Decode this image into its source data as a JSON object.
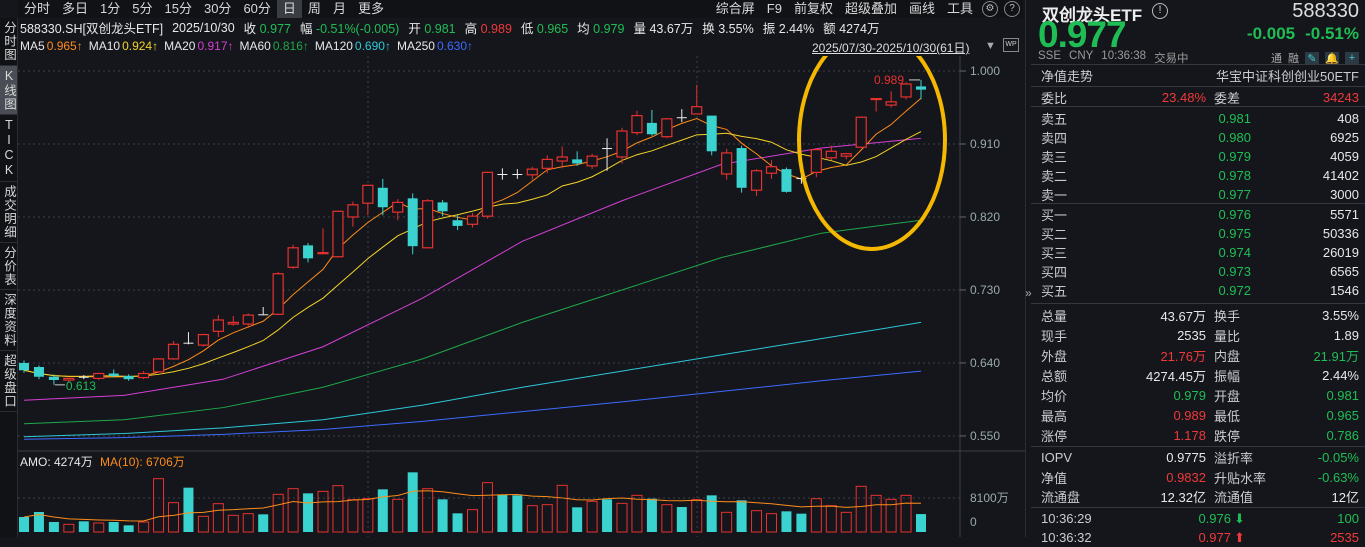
{
  "toolbar": {
    "periods": [
      "分时",
      "多日",
      "1分",
      "5分",
      "15分",
      "30分",
      "60分",
      "日",
      "周",
      "月",
      "更多"
    ],
    "active": "日",
    "right": [
      "综合屏",
      "F9",
      "前复权",
      "超级叠加",
      "画线",
      "工具"
    ]
  },
  "left_tabs": [
    "分时图",
    "K线图",
    "TICK",
    "成交明细",
    "分价表",
    "深度资料",
    "超级盘口"
  ],
  "info": {
    "code": "588330.SH[双创龙头ETF]",
    "date": "2025/10/30",
    "close_label": "收",
    "close": "0.977",
    "chg_label": "幅",
    "chg": "-0.51%(-0.005)",
    "open_label": "开",
    "open": "0.981",
    "high_label": "高",
    "high": "0.989",
    "low_label": "低",
    "low": "0.965",
    "avg_label": "均",
    "avg": "0.979",
    "vol_label": "量",
    "vol": "43.67万",
    "turn_label": "换",
    "turn": "3.55%",
    "amp_label": "振",
    "amp": "2.44%",
    "amt_label": "额",
    "amt": "4274万"
  },
  "ma_legend": [
    {
      "name": "MA5",
      "value": "0.965↑",
      "color": "#ff8c1a"
    },
    {
      "name": "MA10",
      "value": "0.924↑",
      "color": "#f5d327"
    },
    {
      "name": "MA20",
      "value": "0.917↑",
      "color": "#d63fd6"
    },
    {
      "name": "MA60",
      "value": "0.816↑",
      "color": "#1fa84a"
    },
    {
      "name": "MA120",
      "value": "0.690↑",
      "color": "#2ec8d8"
    },
    {
      "name": "MA250",
      "value": "0.630↑",
      "color": "#3d6bff"
    }
  ],
  "range": "2025/07/30-2025/10/30(61日)",
  "chart_data": {
    "type": "candlestick",
    "y_ticks": [
      "1.000",
      "0.910",
      "0.820",
      "0.730",
      "0.640",
      "0.550"
    ],
    "ylim": [
      0.55,
      1.0
    ],
    "ohlc": [
      [
        0.64,
        0.643,
        0.628,
        0.631
      ],
      [
        0.635,
        0.637,
        0.62,
        0.623
      ],
      [
        0.623,
        0.626,
        0.613,
        0.619
      ],
      [
        0.619,
        0.622,
        0.617,
        0.621
      ],
      [
        0.623,
        0.625,
        0.62,
        0.623
      ],
      [
        0.621,
        0.628,
        0.619,
        0.627
      ],
      [
        0.627,
        0.632,
        0.622,
        0.624
      ],
      [
        0.624,
        0.626,
        0.618,
        0.62
      ],
      [
        0.622,
        0.63,
        0.62,
        0.627
      ],
      [
        0.629,
        0.646,
        0.628,
        0.645
      ],
      [
        0.645,
        0.667,
        0.644,
        0.663
      ],
      [
        0.665,
        0.678,
        0.663,
        0.665
      ],
      [
        0.662,
        0.676,
        0.66,
        0.675
      ],
      [
        0.679,
        0.699,
        0.672,
        0.693
      ],
      [
        0.688,
        0.698,
        0.686,
        0.69
      ],
      [
        0.688,
        0.701,
        0.683,
        0.699
      ],
      [
        0.7,
        0.709,
        0.699,
        0.7
      ],
      [
        0.7,
        0.752,
        0.699,
        0.75
      ],
      [
        0.758,
        0.786,
        0.756,
        0.782
      ],
      [
        0.785,
        0.788,
        0.764,
        0.769
      ],
      [
        0.775,
        0.806,
        0.774,
        0.776
      ],
      [
        0.771,
        0.828,
        0.77,
        0.827
      ],
      [
        0.82,
        0.839,
        0.808,
        0.835
      ],
      [
        0.837,
        0.86,
        0.822,
        0.859
      ],
      [
        0.856,
        0.867,
        0.822,
        0.832
      ],
      [
        0.826,
        0.842,
        0.816,
        0.838
      ],
      [
        0.843,
        0.849,
        0.774,
        0.784
      ],
      [
        0.782,
        0.842,
        0.782,
        0.84
      ],
      [
        0.838,
        0.841,
        0.821,
        0.827
      ],
      [
        0.816,
        0.822,
        0.804,
        0.809
      ],
      [
        0.811,
        0.825,
        0.807,
        0.821
      ],
      [
        0.821,
        0.876,
        0.818,
        0.875
      ],
      [
        0.873,
        0.88,
        0.866,
        0.873
      ],
      [
        0.873,
        0.879,
        0.867,
        0.873
      ],
      [
        0.872,
        0.882,
        0.866,
        0.879
      ],
      [
        0.88,
        0.896,
        0.874,
        0.891
      ],
      [
        0.889,
        0.907,
        0.88,
        0.894
      ],
      [
        0.891,
        0.901,
        0.883,
        0.886
      ],
      [
        0.883,
        0.898,
        0.879,
        0.895
      ],
      [
        0.905,
        0.917,
        0.877,
        0.905
      ],
      [
        0.894,
        0.93,
        0.886,
        0.926
      ],
      [
        0.924,
        0.951,
        0.921,
        0.945
      ],
      [
        0.936,
        0.952,
        0.92,
        0.922
      ],
      [
        0.919,
        0.942,
        0.917,
        0.941
      ],
      [
        0.943,
        0.953,
        0.937,
        0.943
      ],
      [
        0.947,
        0.983,
        0.947,
        0.956
      ],
      [
        0.945,
        0.945,
        0.896,
        0.901
      ],
      [
        0.873,
        0.904,
        0.866,
        0.899
      ],
      [
        0.905,
        0.908,
        0.85,
        0.856
      ],
      [
        0.853,
        0.879,
        0.846,
        0.877
      ],
      [
        0.874,
        0.89,
        0.867,
        0.882
      ],
      [
        0.879,
        0.881,
        0.85,
        0.851
      ],
      [
        0.868,
        0.872,
        0.861,
        0.868
      ],
      [
        0.875,
        0.905,
        0.869,
        0.903
      ],
      [
        0.893,
        0.908,
        0.89,
        0.901
      ],
      [
        0.895,
        0.899,
        0.891,
        0.898
      ],
      [
        0.906,
        0.944,
        0.905,
        0.943
      ],
      [
        0.965,
        0.965,
        0.95,
        0.966
      ],
      [
        0.958,
        0.975,
        0.955,
        0.962
      ],
      [
        0.968,
        0.986,
        0.965,
        0.984
      ],
      [
        0.981,
        0.989,
        0.965,
        0.977
      ]
    ],
    "ma_long": {
      "MA20": [
        0.594,
        0.6,
        0.62,
        0.66,
        0.72,
        0.79,
        0.84,
        0.885,
        0.905,
        0.917
      ],
      "MA60": [
        0.565,
        0.57,
        0.585,
        0.61,
        0.645,
        0.69,
        0.73,
        0.77,
        0.8,
        0.816
      ],
      "MA120": [
        0.549,
        0.553,
        0.56,
        0.57,
        0.588,
        0.61,
        0.63,
        0.65,
        0.67,
        0.69
      ],
      "MA250": [
        0.546,
        0.548,
        0.552,
        0.558,
        0.568,
        0.58,
        0.592,
        0.605,
        0.618,
        0.63
      ]
    },
    "high_marker": "0.989",
    "low_marker": "0.613",
    "volume": {
      "label": "AMO: 4274万",
      "ma_label": "MA(10): 6706万",
      "tick": "8100万",
      "zero": "0",
      "values": [
        3573,
        4764,
        2382,
        1826,
        2541,
        2144,
        2382,
        1588,
        2382,
        12704,
        6987,
        10560,
        3732,
        6749,
        3970,
        4367,
        4208,
        8972,
        10322,
        9210,
        9687,
        11037,
        7702,
        7940,
        10163,
        7781,
        14213,
        10322,
        7781,
        4446,
        5320,
        11751,
        8893,
        8734,
        6273,
        6511,
        11116,
        5876,
        7305,
        7781,
        6828,
        8734,
        7940,
        6511,
        5955,
        7702,
        8734,
        4685,
        7543,
        5082,
        4367,
        4923,
        4367,
        7940,
        6273,
        4685,
        10878,
        8734,
        7781,
        8734,
        4274
      ]
    }
  },
  "quote": {
    "name": "双创龙头ETF",
    "code": "588330",
    "price": "0.977",
    "chg": "-0.005",
    "pct": "-0.51%",
    "exchange": "SSE",
    "currency": "CNY",
    "time": "10:36:38",
    "status": "交易中",
    "tag1": "通",
    "tag2": "融",
    "nav_trend": "净值走势",
    "fund_name": "华宝中证科创创业50ETF"
  },
  "committee": {
    "ratio_label": "委比",
    "ratio": "23.48%",
    "diff_label": "委差",
    "diff": "34243"
  },
  "asks": [
    {
      "label": "卖五",
      "price": "0.981",
      "vol": "408"
    },
    {
      "label": "卖四",
      "price": "0.980",
      "vol": "6925"
    },
    {
      "label": "卖三",
      "price": "0.979",
      "vol": "4059"
    },
    {
      "label": "卖二",
      "price": "0.978",
      "vol": "41402"
    },
    {
      "label": "卖一",
      "price": "0.977",
      "vol": "3000"
    }
  ],
  "bids": [
    {
      "label": "买一",
      "price": "0.976",
      "vol": "5571"
    },
    {
      "label": "买二",
      "price": "0.975",
      "vol": "50336"
    },
    {
      "label": "买三",
      "price": "0.974",
      "vol": "26019"
    },
    {
      "label": "买四",
      "price": "0.973",
      "vol": "6565"
    },
    {
      "label": "买五",
      "price": "0.972",
      "vol": "1546"
    }
  ],
  "stats": [
    {
      "l1": "总量",
      "v1": "43.67万",
      "c1": "w",
      "l2": "换手",
      "v2": "3.55%",
      "c2": "w"
    },
    {
      "l1": "现手",
      "v1": "2535",
      "c1": "w",
      "l2": "量比",
      "v2": "1.89",
      "c2": "w"
    },
    {
      "l1": "外盘",
      "v1": "21.76万",
      "c1": "r",
      "l2": "内盘",
      "v2": "21.91万",
      "c2": "g"
    },
    {
      "l1": "总额",
      "v1": "4274.45万",
      "c1": "w",
      "l2": "振幅",
      "v2": "2.44%",
      "c2": "w"
    },
    {
      "l1": "均价",
      "v1": "0.979",
      "c1": "g",
      "l2": "开盘",
      "v2": "0.981",
      "c2": "g"
    },
    {
      "l1": "最高",
      "v1": "0.989",
      "c1": "r",
      "l2": "最低",
      "v2": "0.965",
      "c2": "g"
    },
    {
      "l1": "涨停",
      "v1": "1.178",
      "c1": "r",
      "l2": "跌停",
      "v2": "0.786",
      "c2": "g"
    }
  ],
  "fund_stats": [
    {
      "l1": "IOPV",
      "v1": "0.9775",
      "c1": "w",
      "l2": "溢折率",
      "v2": "-0.05%",
      "c2": "g"
    },
    {
      "l1": "净值",
      "v1": "0.9832",
      "c1": "r",
      "l2": "升贴水率",
      "v2": "-0.63%",
      "c2": "g"
    },
    {
      "l1": "流通盘",
      "v1": "12.32亿",
      "c1": "w",
      "l2": "流通值",
      "v2": "12亿",
      "c2": "w"
    }
  ],
  "ticks": [
    {
      "time": "10:36:29",
      "price": "0.976",
      "dir": "down",
      "vol": "100"
    },
    {
      "time": "10:36:32",
      "price": "0.977",
      "dir": "up",
      "vol": "2535"
    }
  ],
  "colors": {
    "up": "#e8312f",
    "down": "#3ad3cf",
    "annotation": "#f5b800"
  }
}
